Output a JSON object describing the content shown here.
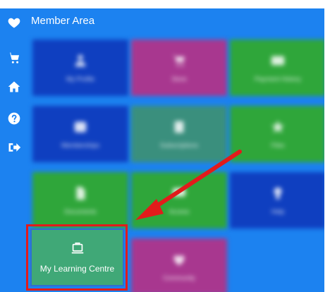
{
  "header": {
    "title": "Member Area"
  },
  "sidebar": {
    "items": [
      {
        "icon": "heart-icon"
      },
      {
        "icon": "shopping-cart-icon"
      },
      {
        "icon": "home-icon"
      },
      {
        "icon": "help-icon"
      },
      {
        "icon": "sign-out-icon"
      }
    ]
  },
  "tiles": [
    {
      "label": "My Profile",
      "icon": "user-icon",
      "color": "#0f3fc0"
    },
    {
      "label": "Store",
      "icon": "cart-icon",
      "color": "#a8378f"
    },
    {
      "label": "Payment History",
      "icon": "card-icon",
      "color": "#2fa63a"
    },
    {
      "label": "Memberships",
      "icon": "id-card-icon",
      "color": "#0f3fc0"
    },
    {
      "label": "Subscriptions",
      "icon": "document-icon",
      "color": "#3a8f7d"
    },
    {
      "label": "Files",
      "icon": "star-icon",
      "color": "#2fa63a"
    },
    {
      "label": "Documents",
      "icon": "file-icon",
      "color": "#2fa63a"
    },
    {
      "label": "Access",
      "icon": "chat-icon",
      "color": "#2fa63a"
    },
    {
      "label": "Help",
      "icon": "bulb-icon",
      "color": "#0f3fc0"
    },
    {
      "label": "Community",
      "icon": "heart-shield-icon",
      "color": "#a8378f"
    }
  ],
  "highlighted_tile": {
    "label": "My Learning Centre",
    "icon": "laptop-icon"
  },
  "colors": {
    "background": "#1c82f0",
    "highlight": "#e21b1b",
    "arrow": "#e21b1b"
  }
}
